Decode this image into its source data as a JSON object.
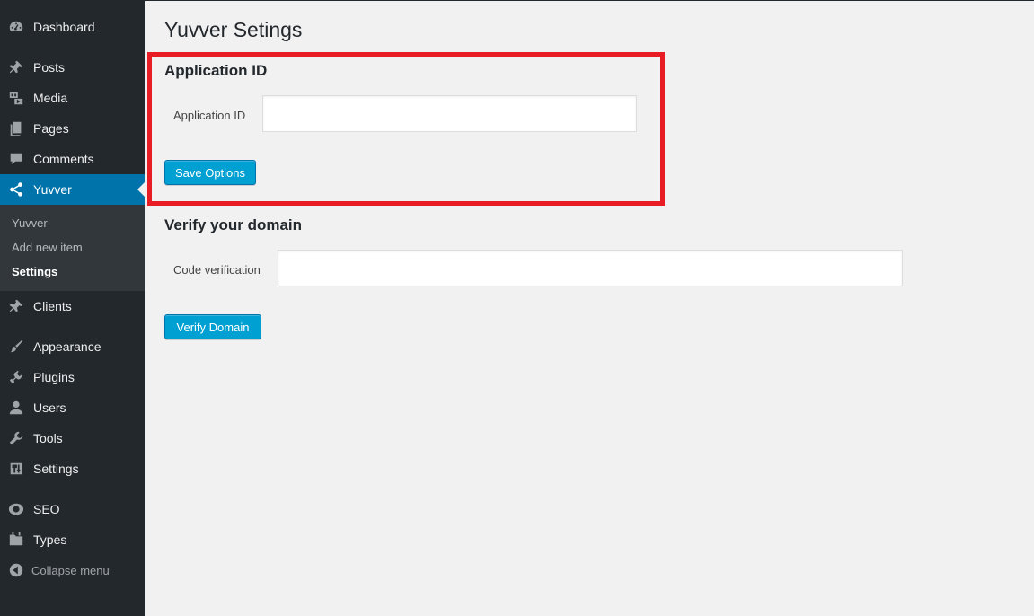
{
  "sidebar": {
    "items": [
      {
        "label": "Dashboard",
        "icon": "dashboard-icon"
      },
      {
        "label": "Posts",
        "icon": "pin-icon"
      },
      {
        "label": "Media",
        "icon": "media-icon"
      },
      {
        "label": "Pages",
        "icon": "pages-icon"
      },
      {
        "label": "Comments",
        "icon": "comments-icon"
      },
      {
        "label": "Yuvver",
        "icon": "share-icon"
      },
      {
        "label": "Clients",
        "icon": "pin-icon"
      },
      {
        "label": "Appearance",
        "icon": "brush-icon"
      },
      {
        "label": "Plugins",
        "icon": "plugin-icon"
      },
      {
        "label": "Users",
        "icon": "user-icon"
      },
      {
        "label": "Tools",
        "icon": "wrench-icon"
      },
      {
        "label": "Settings",
        "icon": "settings-icon"
      },
      {
        "label": "SEO",
        "icon": "seo-icon"
      },
      {
        "label": "Types",
        "icon": "folder-icon"
      }
    ],
    "submenu": [
      "Yuvver",
      "Add new item",
      "Settings"
    ],
    "collapse_label": "Collapse menu"
  },
  "main": {
    "page_title": "Yuvver Setings",
    "app_section": {
      "title": "Application ID",
      "field_label": "Application ID",
      "field_value": "",
      "button_label": "Save Options"
    },
    "verify_section": {
      "title": "Verify your domain",
      "field_label": "Code verification",
      "field_value": "",
      "button_label": "Verify Domain"
    }
  },
  "colors": {
    "sidebar_bg": "#23282d",
    "submenu_bg": "#32373c",
    "current_item_bg": "#0073aa",
    "button_bg": "#00a0d2",
    "highlight_border": "#e81c24"
  }
}
